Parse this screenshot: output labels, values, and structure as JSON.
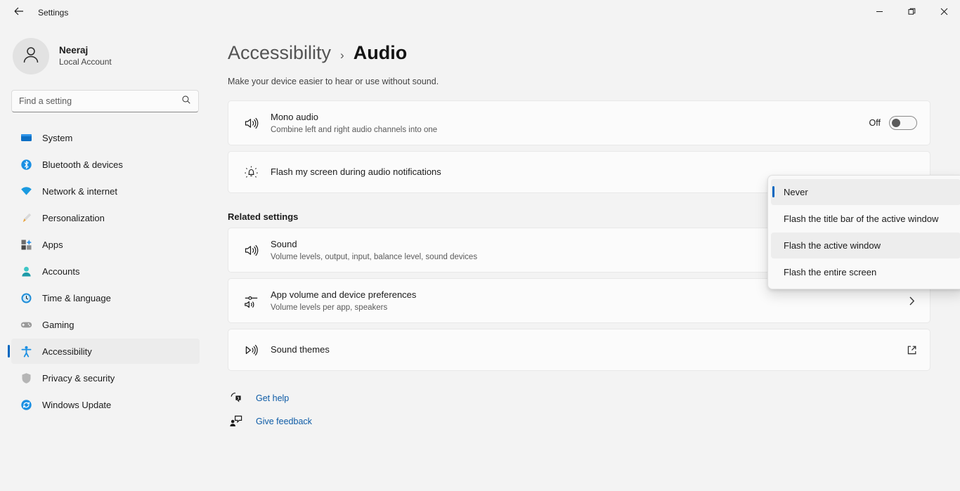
{
  "window": {
    "app_title": "Settings",
    "back_icon": "arrow-left-icon",
    "controls": [
      {
        "name": "minimize-button",
        "icon": "minimize-icon"
      },
      {
        "name": "maximize-button",
        "icon": "restore-icon"
      },
      {
        "name": "close-button",
        "icon": "close-icon"
      }
    ]
  },
  "sidebar": {
    "account": {
      "name": "Neeraj",
      "type": "Local Account",
      "avatar_icon": "person-icon"
    },
    "search": {
      "placeholder": "Find a setting",
      "value": "",
      "icon": "search-icon"
    },
    "items": [
      {
        "label": "System",
        "icon": "monitor-icon",
        "selected": false
      },
      {
        "label": "Bluetooth & devices",
        "icon": "bluetooth-icon",
        "selected": false
      },
      {
        "label": "Network & internet",
        "icon": "wifi-icon",
        "selected": false
      },
      {
        "label": "Personalization",
        "icon": "paintbrush-icon",
        "selected": false
      },
      {
        "label": "Apps",
        "icon": "apps-icon",
        "selected": false
      },
      {
        "label": "Accounts",
        "icon": "account-icon",
        "selected": false
      },
      {
        "label": "Time & language",
        "icon": "clock-icon",
        "selected": false
      },
      {
        "label": "Gaming",
        "icon": "gamepad-icon",
        "selected": false
      },
      {
        "label": "Accessibility",
        "icon": "accessibility-icon",
        "selected": true
      },
      {
        "label": "Privacy & security",
        "icon": "shield-icon",
        "selected": false
      },
      {
        "label": "Windows Update",
        "icon": "update-icon",
        "selected": false
      }
    ]
  },
  "main": {
    "breadcrumb": {
      "parent": "Accessibility",
      "separator": "›",
      "current": "Audio"
    },
    "subtitle": "Make your device easier to hear or use without sound.",
    "mono_audio": {
      "icon": "speaker-icon",
      "title": "Mono audio",
      "subtitle": "Combine left and right audio channels into one",
      "toggle_label": "Off",
      "toggle_state": "off"
    },
    "flash_screen": {
      "icon": "flash-notification-icon",
      "title": "Flash my screen during audio notifications",
      "selected_value": "Never"
    },
    "related_heading": "Related settings",
    "related": [
      {
        "icon": "speaker-icon",
        "title": "Sound",
        "subtitle": "Volume levels, output, input, balance level, sound devices",
        "action_icon": ""
      },
      {
        "icon": "app-volume-icon",
        "title": "App volume and device preferences",
        "subtitle": "Volume levels per app, speakers",
        "action_icon": "chevron-right-icon"
      },
      {
        "icon": "sound-themes-icon",
        "title": "Sound themes",
        "subtitle": "",
        "action_icon": "external-link-icon"
      }
    ],
    "footer": [
      {
        "label": "Get help",
        "icon": "help-icon"
      },
      {
        "label": "Give feedback",
        "icon": "feedback-icon"
      }
    ]
  },
  "dropdown": {
    "open": true,
    "options": [
      {
        "label": "Never",
        "selected": true,
        "hover": false
      },
      {
        "label": "Flash the title bar of the active window",
        "selected": false,
        "hover": false
      },
      {
        "label": "Flash the active window",
        "selected": false,
        "hover": true
      },
      {
        "label": "Flash the entire screen",
        "selected": false,
        "hover": false
      }
    ]
  },
  "colors": {
    "accent": "#0067c0",
    "link": "#0d5ba6",
    "page_bg": "#f3f3f3",
    "card_bg": "#fbfbfb"
  }
}
